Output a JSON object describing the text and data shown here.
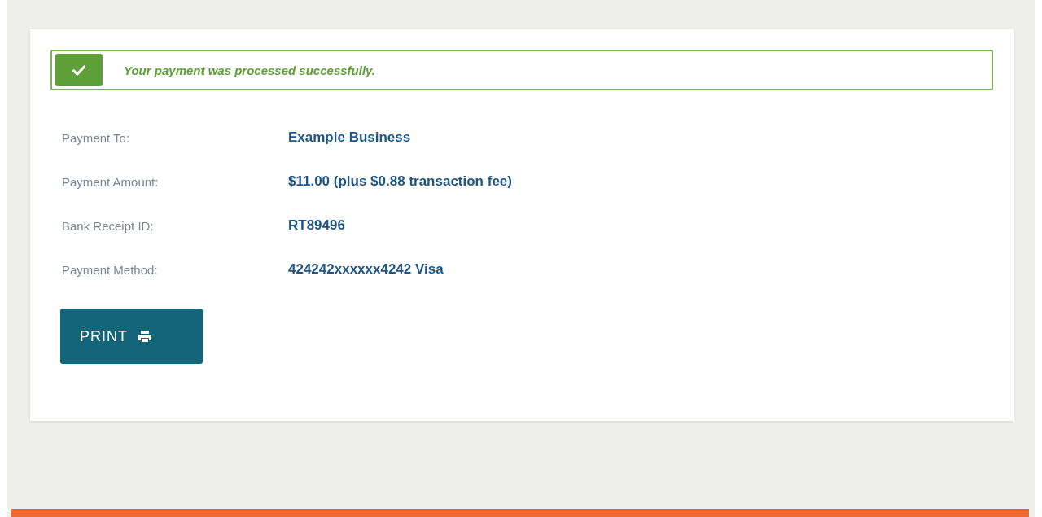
{
  "alert": {
    "text": "Your payment was processed successfully."
  },
  "details": [
    {
      "label": "Payment To:",
      "value": "Example Business"
    },
    {
      "label": "Payment Amount:",
      "value": "$11.00 (plus $0.88 transaction fee)"
    },
    {
      "label": "Bank Receipt ID:",
      "value": "RT89496"
    },
    {
      "label": "Payment Method:",
      "value": "424242xxxxxx4242 Visa"
    }
  ],
  "print_button": {
    "label": "PRINT"
  }
}
